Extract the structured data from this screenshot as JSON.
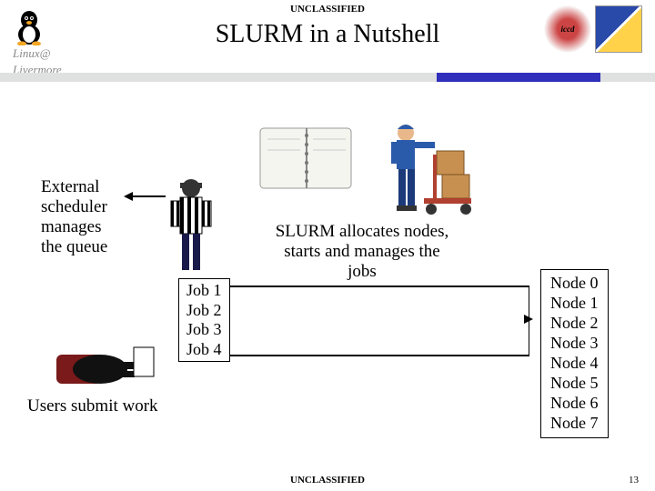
{
  "header": {
    "classification": "UNCLASSIFIED",
    "title": "SLURM in a Nutshell"
  },
  "logos": {
    "left": "Linux@ Livermore",
    "right1": "iccd",
    "right2": "LLNL"
  },
  "scheduler_text": {
    "l1": "External",
    "l2": "scheduler",
    "l3": "manages",
    "l4": "the queue"
  },
  "jobs": [
    "Job 1",
    "Job 2",
    "Job 3",
    "Job 4"
  ],
  "submit_text": "Users submit work",
  "slurm_text": {
    "l1": "SLURM allocates nodes,",
    "l2": "starts and manages the",
    "l3": "jobs"
  },
  "nodes": [
    "Node 0",
    "Node 1",
    "Node 2",
    "Node 3",
    "Node 4",
    "Node 5",
    "Node 6",
    "Node 7"
  ],
  "footer": {
    "classification": "UNCLASSIFIED",
    "page": "13"
  }
}
